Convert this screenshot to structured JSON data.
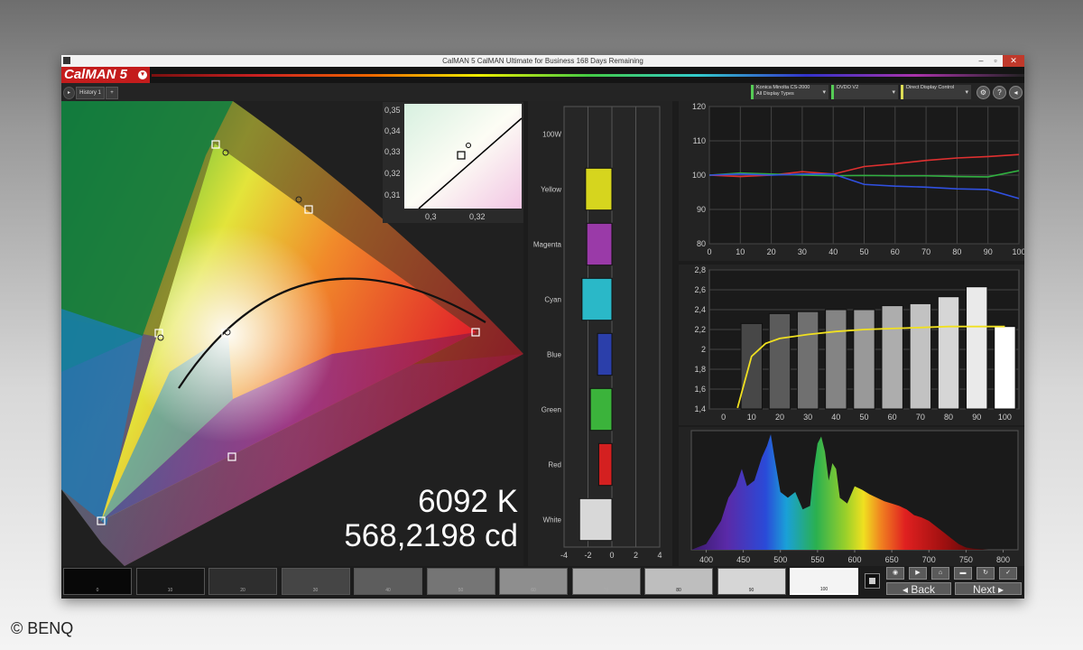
{
  "window": {
    "title": "CalMAN 5 CalMAN Ultimate for Business 168 Days Remaining",
    "controls": [
      "–",
      "▫",
      "✕"
    ]
  },
  "app": {
    "logo_text": "CalMAN 5"
  },
  "toolbar": {
    "history_tab": "History 1",
    "meter": {
      "line1": "Konica Minolta CS-2000",
      "line2": "All Display Types"
    },
    "source": {
      "line1": "DVDO V2",
      "line2": ""
    },
    "display": {
      "line1": "Direct Display Control",
      "line2": ""
    },
    "right_icons": [
      "gear-icon",
      "help-icon",
      "back-icon"
    ]
  },
  "cie": {
    "inset_y_ticks": [
      "0,35",
      "0,34",
      "0,33",
      "0,32",
      "0,31"
    ],
    "inset_x_ticks": [
      "0,3",
      "0,32"
    ],
    "cct": "6092 K",
    "luminance": "568,2198 cd"
  },
  "swatch_chart": {
    "labels": [
      "100W",
      "Yellow",
      "Magenta",
      "Cyan",
      "Blue",
      "Green",
      "Red",
      "White"
    ],
    "x_ticks": [
      "-4",
      "-2",
      "0",
      "2",
      "4"
    ],
    "bars": [
      {
        "name": "Yellow",
        "value": -2.2,
        "color": "#d6d51e"
      },
      {
        "name": "Magenta",
        "value": -2.1,
        "color": "#9a3aa8"
      },
      {
        "name": "Cyan",
        "value": -2.5,
        "color": "#2ab8c8"
      },
      {
        "name": "Blue",
        "value": -1.2,
        "color": "#2b3faa"
      },
      {
        "name": "Green",
        "value": -1.8,
        "color": "#3bb33b"
      },
      {
        "name": "Red",
        "value": -1.1,
        "color": "#d42020"
      },
      {
        "name": "White",
        "value": -2.7,
        "color": "#d8d8d8"
      }
    ]
  },
  "chart_data": [
    {
      "type": "line",
      "x": [
        0,
        10,
        20,
        30,
        40,
        50,
        60,
        70,
        80,
        90,
        100
      ],
      "ylim": [
        80,
        120
      ],
      "y_ticks": [
        "120",
        "110",
        "100",
        "90",
        "80"
      ],
      "x_ticks": [
        "0",
        "10",
        "20",
        "30",
        "40",
        "50",
        "60",
        "70",
        "80",
        "90",
        "100"
      ],
      "series": [
        {
          "color": "#e03030",
          "values": [
            100,
            99.6,
            100,
            101,
            100.3,
            102.5,
            103.3,
            104.3,
            105,
            105.4,
            106
          ]
        },
        {
          "color": "#30b040",
          "values": [
            100,
            100.6,
            100.3,
            100,
            99.8,
            99.9,
            99.8,
            99.8,
            99.6,
            99.5,
            101.3
          ]
        },
        {
          "color": "#3050e0",
          "values": [
            100,
            100.3,
            100,
            100.3,
            100.3,
            97.3,
            96.8,
            96.5,
            96,
            95.8,
            93.2
          ]
        }
      ]
    },
    {
      "type": "bar",
      "categories": [
        "10",
        "20",
        "30",
        "40",
        "50",
        "60",
        "70",
        "80",
        "90",
        "100"
      ],
      "values": [
        2.26,
        2.36,
        2.38,
        2.4,
        2.4,
        2.44,
        2.46,
        2.53,
        2.63,
        2.23
      ],
      "ylim": [
        1.4,
        2.8
      ],
      "y_ticks": [
        "2,8",
        "2,6",
        "2,4",
        "2,2",
        "2",
        "1,8",
        "1,6",
        "1,4"
      ],
      "x_ticks": [
        "0",
        "10",
        "20",
        "30",
        "40",
        "50",
        "60",
        "70",
        "80",
        "90",
        "100"
      ],
      "line": {
        "color": "#f0e020",
        "x": [
          5,
          10,
          15,
          20,
          30,
          40,
          50,
          60,
          70,
          80,
          90,
          100
        ],
        "values": [
          1.41,
          1.93,
          2.06,
          2.11,
          2.15,
          2.18,
          2.2,
          2.21,
          2.22,
          2.23,
          2.23,
          2.23
        ]
      }
    },
    {
      "type": "area",
      "x_ticks": [
        "400",
        "450",
        "500",
        "550",
        "600",
        "650",
        "700",
        "750",
        "800"
      ],
      "x": [
        380,
        400,
        420,
        430,
        440,
        448,
        455,
        465,
        475,
        482,
        487,
        492,
        500,
        510,
        520,
        530,
        540,
        545,
        550,
        555,
        560,
        565,
        570,
        575,
        580,
        590,
        600,
        610,
        620,
        630,
        640,
        650,
        660,
        670,
        680,
        690,
        700,
        710,
        720,
        730,
        740,
        750,
        760,
        780
      ],
      "values": [
        0,
        0.05,
        0.25,
        0.45,
        0.55,
        0.7,
        0.55,
        0.6,
        0.8,
        0.9,
        1.0,
        0.8,
        0.5,
        0.45,
        0.5,
        0.35,
        0.38,
        0.7,
        0.92,
        0.98,
        0.85,
        0.6,
        0.75,
        0.7,
        0.45,
        0.4,
        0.55,
        0.52,
        0.48,
        0.45,
        0.42,
        0.4,
        0.38,
        0.35,
        0.3,
        0.28,
        0.25,
        0.2,
        0.15,
        0.1,
        0.05,
        0.02,
        0.01,
        0
      ]
    }
  ],
  "patches": [
    {
      "label": "0",
      "color": "#080808"
    },
    {
      "label": "10",
      "color": "#161616"
    },
    {
      "label": "20",
      "color": "#2e2e2e"
    },
    {
      "label": "30",
      "color": "#454545"
    },
    {
      "label": "40",
      "color": "#5d5d5d"
    },
    {
      "label": "50",
      "color": "#757575"
    },
    {
      "label": "60",
      "color": "#8e8e8e"
    },
    {
      "label": "70",
      "color": "#a6a6a6"
    },
    {
      "label": "80",
      "color": "#bebebe"
    },
    {
      "label": "90",
      "color": "#d6d6d6"
    },
    {
      "label": "100",
      "color": "#f4f4f4"
    }
  ],
  "nav": {
    "back": "Back",
    "next": "Next"
  },
  "copyright": "© BENQ"
}
